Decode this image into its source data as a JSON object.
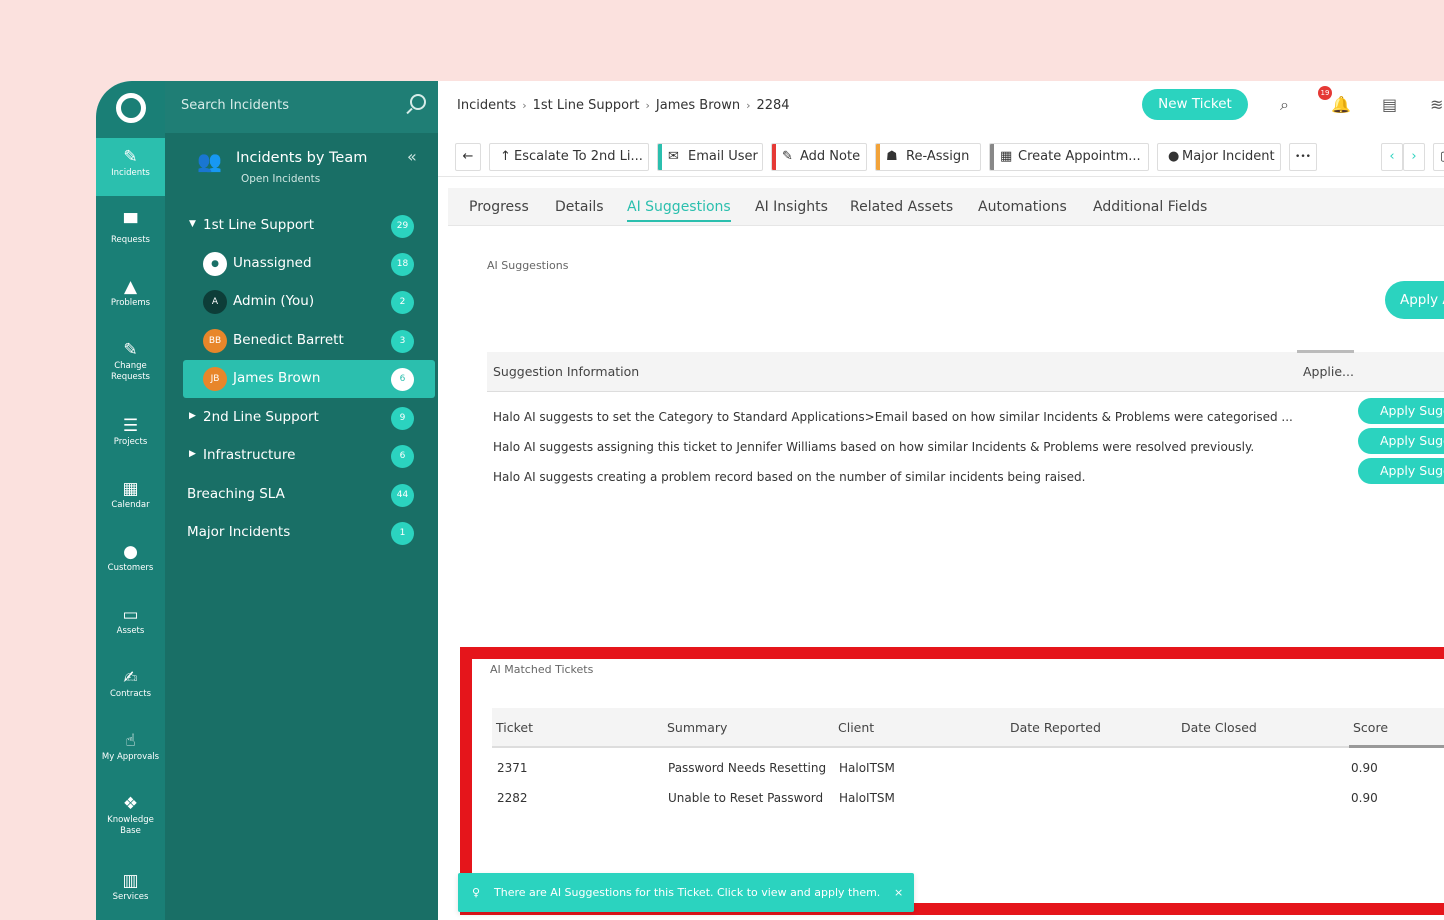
{
  "rail": {
    "items": [
      {
        "label": "Incidents"
      },
      {
        "label": "Requests"
      },
      {
        "label": "Problems"
      },
      {
        "label": "Change Requests"
      },
      {
        "label": "Projects"
      },
      {
        "label": "Calendar"
      },
      {
        "label": "Customers"
      },
      {
        "label": "Assets"
      },
      {
        "label": "Contracts"
      },
      {
        "label": "My Approvals"
      },
      {
        "label": "Knowledge Base"
      },
      {
        "label": "Services"
      }
    ]
  },
  "panel": {
    "search_placeholder": "Search Incidents",
    "title": "Incidents by Team",
    "subtitle": "Open Incidents",
    "tree": [
      {
        "label": "1st Line Support",
        "count": "29"
      },
      {
        "label": "Unassigned",
        "count": "18"
      },
      {
        "label": "Admin (You)",
        "count": "2",
        "initials": "A"
      },
      {
        "label": "Benedict Barrett",
        "count": "3",
        "initials": "BB"
      },
      {
        "label": "James Brown",
        "count": "6",
        "initials": "JB"
      },
      {
        "label": "2nd Line Support",
        "count": "9"
      },
      {
        "label": "Infrastructure",
        "count": "6"
      },
      {
        "label": "Breaching SLA",
        "count": "44"
      },
      {
        "label": "Major Incidents",
        "count": "1"
      }
    ]
  },
  "topbar": {
    "crumbs": [
      "Incidents",
      "1st Line Support",
      "James Brown",
      "2284"
    ],
    "new_ticket": "New Ticket",
    "notif_count": "19"
  },
  "toolbar": {
    "escalate": "Escalate To 2nd Li...",
    "email": "Email User",
    "note": "Add Note",
    "reassign": "Re-Assign",
    "appointment": "Create Appointm...",
    "major": "Major Incident",
    "more": "•••"
  },
  "tabs": [
    "Progress",
    "Details",
    "AI Suggestions",
    "AI Insights",
    "Related Assets",
    "Automations",
    "Additional Fields"
  ],
  "suggestions": {
    "section_title": "AI Suggestions",
    "apply_all": "Apply All",
    "col_info": "Suggestion Information",
    "col_applied": "Applie...",
    "rows": [
      {
        "text": "Halo AI suggests to set the Category to Standard Applications>Email based on how similar Incidents & Problems were categorised ...",
        "action": "Apply Suggestion"
      },
      {
        "text": "Halo AI suggests assigning this ticket to Jennifer Williams based on how similar Incidents & Problems were resolved previously.",
        "action": "Apply Suggestion"
      },
      {
        "text": "Halo AI suggests creating a problem record based on the number of similar incidents being raised.",
        "action": "Apply Suggestion"
      }
    ]
  },
  "matched": {
    "section_title": "AI Matched Tickets",
    "columns": [
      "Ticket",
      "Summary",
      "Client",
      "Date Reported",
      "Date Closed",
      "Score"
    ],
    "rows": [
      {
        "ticket": "2371",
        "summary": "Password Needs Resetting",
        "client": "HaloITSM",
        "reported": "",
        "closed": "",
        "score": "0.90"
      },
      {
        "ticket": "2282",
        "summary": "Unable to Reset Password",
        "client": "HaloITSM",
        "reported": "",
        "closed": "",
        "score": "0.90"
      }
    ]
  },
  "toast": {
    "message": "There are AI Suggestions for this Ticket. Click to view and apply them.",
    "close": "×"
  },
  "colors": {
    "accent": "#2bd3bf",
    "sidebar": "#196f66",
    "highlight_border": "#e5151b"
  }
}
